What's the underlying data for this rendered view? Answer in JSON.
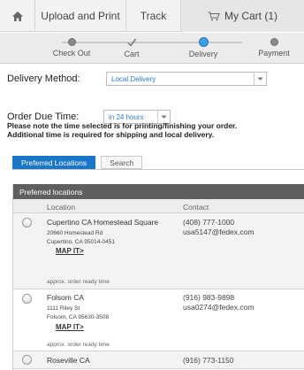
{
  "nav": {
    "home_icon": "home-icon",
    "tabs": [
      "Upload and Print",
      "Track"
    ],
    "cart_label": "My Cart (1)",
    "cart_icon": "cart-icon"
  },
  "steps": [
    {
      "label": "Check Out",
      "state": "done"
    },
    {
      "label": "Cart",
      "state": "check"
    },
    {
      "label": "Delivery",
      "state": "active"
    },
    {
      "label": "Payment",
      "state": "pending"
    }
  ],
  "delivery": {
    "label": "Delivery Method:",
    "value": "Local Delivery"
  },
  "due": {
    "label": "Order Due Time:",
    "value": "in 24 hours",
    "note_line1": "Please note the time selected is for printing/finishing your order.",
    "note_line2": "Additional time is required for shipping and local delivery."
  },
  "loc_tabs": [
    "Preferred Locations",
    "Search"
  ],
  "table": {
    "title": "Preferred locations",
    "col_location": "Location",
    "col_contact": "Contact",
    "rows": [
      {
        "name": "Cupertino CA Homestead Square",
        "addr1": "20660 Homestead Rd",
        "addr2": "Cupertino, CA 95014-0451",
        "map": "MAP IT>",
        "ready": "approx. order ready time",
        "phone": "(408) 777-1000",
        "email": "usa5147@fedex.com"
      },
      {
        "name": "Folsom CA",
        "addr1": "1111 Riley St",
        "addr2": "Folsom, CA 95630-3508",
        "map": "MAP IT>",
        "ready": "approx. order ready time",
        "phone": "(916) 983-9898",
        "email": "usa0274@fedex.com"
      },
      {
        "name": "Roseville CA",
        "phone": "(916) 773-1150"
      }
    ]
  },
  "colors": {
    "accent": "#1976c8",
    "active_step": "#3d9ee8",
    "table_header": "#5f5f5f"
  }
}
